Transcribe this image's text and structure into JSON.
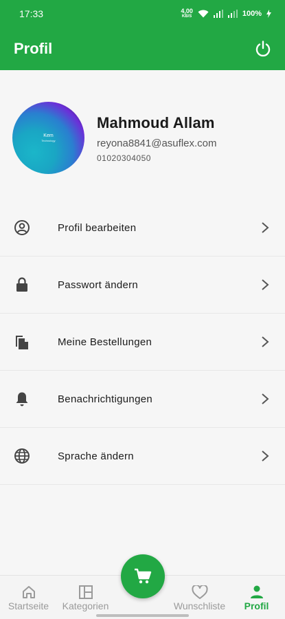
{
  "status_bar": {
    "time": "17:33",
    "network_speed": "4,00",
    "network_unit": "KB/S",
    "battery": "100%"
  },
  "app_bar": {
    "title": "Profil"
  },
  "profile": {
    "avatar_text": "Kem",
    "avatar_subtext": "Technology",
    "name": "Mahmoud Allam",
    "email": "reyona8841@asuflex.com",
    "phone": "01020304050"
  },
  "menu": {
    "items": [
      {
        "label": "Profil bearbeiten",
        "icon": "account-circle-icon"
      },
      {
        "label": "Passwort ändern",
        "icon": "lock-icon"
      },
      {
        "label": "Meine Bestellungen",
        "icon": "copy-document-icon"
      },
      {
        "label": "Benachrichtigungen",
        "icon": "bell-icon"
      },
      {
        "label": "Sprache ändern",
        "icon": "globe-icon"
      }
    ]
  },
  "bottom_nav": {
    "items": [
      {
        "label": "Startseite",
        "icon": "home-icon"
      },
      {
        "label": "Kategorien",
        "icon": "grid-icon"
      },
      {
        "label": "Wunschliste",
        "icon": "heart-icon"
      },
      {
        "label": "Profil",
        "icon": "person-icon",
        "active": true
      }
    ],
    "fab_icon": "cart-icon"
  },
  "colors": {
    "primary": "#22a844",
    "background": "#f6f6f6",
    "inactive": "#9a9a9a"
  }
}
